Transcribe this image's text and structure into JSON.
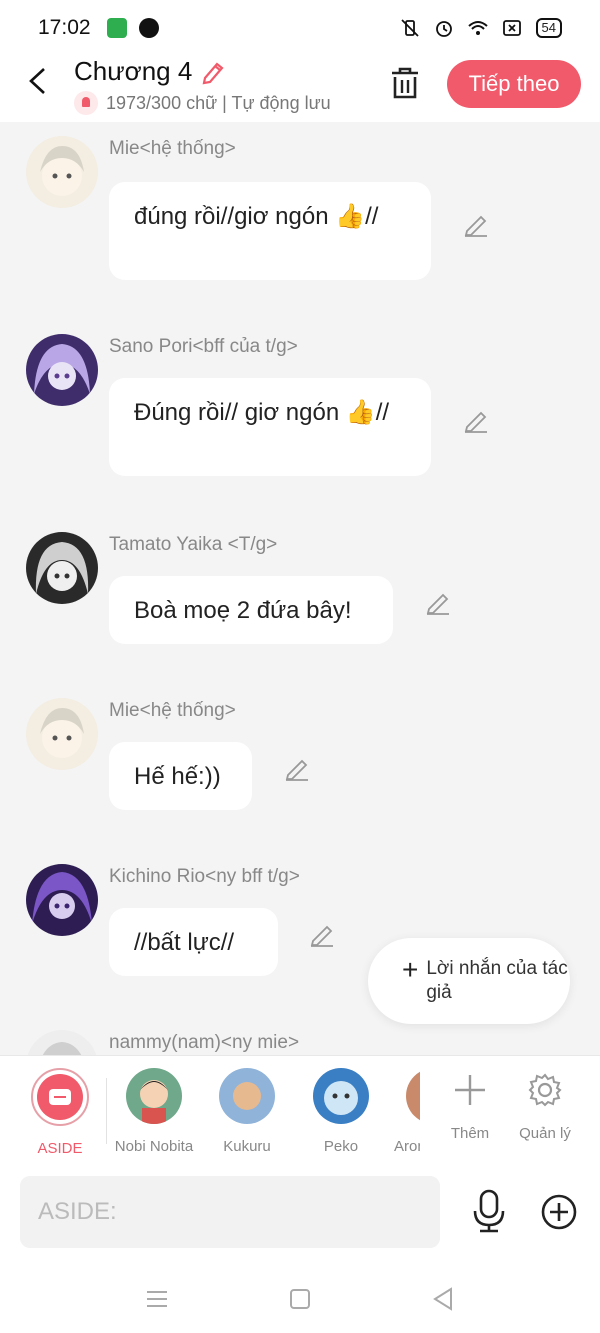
{
  "status": {
    "time": "17:02",
    "battery": "54"
  },
  "header": {
    "title": "Chương 4",
    "subtitle": "1973/300 chữ | Tự động lưu",
    "next_label": "Tiếp theo"
  },
  "messages": [
    {
      "name": "Mie<hệ thống>",
      "text": "đúng rồi//giơ ngón 👍//"
    },
    {
      "name": "Sano Pori<bff của t/g>",
      "text": "Đúng rồi// giơ ngón 👍//"
    },
    {
      "name": "Tamato Yaika <T/g>",
      "text": "Boà moẹ 2 đứa bây!"
    },
    {
      "name": "Mie<hệ thống>",
      "text": "Hế hế:))"
    },
    {
      "name": "Kichino Rio<ny bff t/g>",
      "text": "//bất lực//"
    },
    {
      "name": "nammy(nam)<ny mie>",
      "text": ""
    }
  ],
  "author_note": {
    "label": "Lời nhắn của tác giả"
  },
  "characters": [
    {
      "name": "ASIDE"
    },
    {
      "name": "Nobi Nobita"
    },
    {
      "name": "Kukuru"
    },
    {
      "name": "Peko"
    },
    {
      "name": "Aron"
    }
  ],
  "tools": {
    "add_label": "Thêm",
    "manage_label": "Quản lý"
  },
  "input": {
    "placeholder": "ASIDE:"
  },
  "colors": {
    "accent": "#f15a6b",
    "bg": "#f4f4f4"
  },
  "icons": [
    "back-icon",
    "edit-icon",
    "bell-icon",
    "trash-icon",
    "pencil-icon",
    "plus-icon",
    "gear-icon",
    "microphone-icon",
    "add-circle-icon",
    "menu-icon",
    "home-icon",
    "nav-back-icon"
  ]
}
